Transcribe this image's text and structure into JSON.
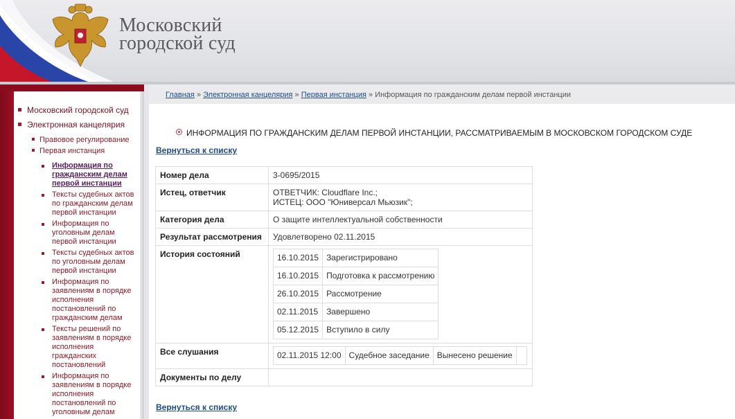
{
  "header": {
    "title_line1": "Московский",
    "title_line2": "городской суд"
  },
  "sidebar": {
    "items": [
      {
        "label": "Московский городской суд"
      },
      {
        "label": "Электронная канцелярия"
      }
    ],
    "subitems": [
      {
        "label": "Правовое регулирование"
      },
      {
        "label": "Первая инстанция"
      }
    ],
    "subsubitems": [
      {
        "label": "Информация по гражданским делам первой инстанции",
        "active": true
      },
      {
        "label": "Тексты судебных актов по гражданским делам первой инстанции"
      },
      {
        "label": "Информация по уголовным делам первой инстанции"
      },
      {
        "label": "Тексты судебных актов по уголовным делам первой инстанции"
      },
      {
        "label": "Информация по заявлениям в порядке исполнения постановлений по гражданским делам"
      },
      {
        "label": "Тексты решений по заявлениям в порядке исполнения гражданских постановлений"
      },
      {
        "label": "Информация по заявлениям в порядке исполнения постановлений по уголовным делам"
      }
    ]
  },
  "breadcrumb": {
    "items": [
      "Главная",
      "Электронная канцелярия",
      "Первая инстанция"
    ],
    "current": "Информация по гражданским делам первой инстанции",
    "separator": "»"
  },
  "content": {
    "title": "ИНФОРМАЦИЯ ПО ГРАЖДАНСКИМ ДЕЛАМ ПЕРВОЙ ИНСТАНЦИИ, РАССМАТРИВАЕМЫМ В МОСКОВСКОМ ГОРОДСКОМ СУДЕ",
    "back_link": "Вернуться к списку",
    "case": {
      "number_label": "Номер дела",
      "number": "3-0695/2015",
      "parties_label": "Истец, ответчик",
      "parties_line1": "ОТВЕТЧИК: Cloudflare Inc.;",
      "parties_line2": "ИСТЕЦ: ООО \"Юниверсал Мьюзик\";",
      "category_label": "Категория дела",
      "category": "О защите интеллектуальной собственности",
      "result_label": "Результат рассмотрения",
      "result": "Удовлетворено 02.11.2015",
      "history_label": "История состояний",
      "history": [
        {
          "date": "16.10.2015",
          "state": "Зарегистрировано"
        },
        {
          "date": "16.10.2015",
          "state": "Подготовка к рассмотрению"
        },
        {
          "date": "26.10.2015",
          "state": "Рассмотрение"
        },
        {
          "date": "02.11.2015",
          "state": "Завершено"
        },
        {
          "date": "05.12.2015",
          "state": "Вступило в силу"
        }
      ],
      "hearings_label": "Все слушания",
      "hearings": [
        {
          "datetime": "02.11.2015 12:00",
          "type": "Судебное заседание",
          "result": "Вынесено решение",
          "extra": ""
        }
      ],
      "documents_label": "Документы по делу",
      "documents": ""
    }
  },
  "colors": {
    "accent_red": "#8b0c1e",
    "link_blue": "#1d4a8a"
  }
}
